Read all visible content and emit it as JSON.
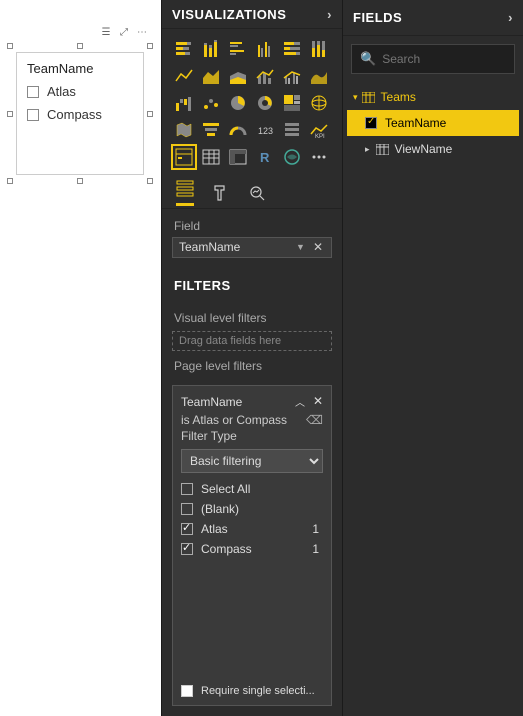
{
  "canvas": {
    "slicer": {
      "title": "TeamName",
      "items": [
        {
          "label": "Atlas",
          "checked": false
        },
        {
          "label": "Compass",
          "checked": false
        }
      ],
      "toolbar_icons": [
        "slicer-mode-icon",
        "focus-icon",
        "more-icon"
      ]
    }
  },
  "visualizations": {
    "header": "VISUALIZATIONS",
    "field_label": "Field",
    "field_value": "TeamName",
    "filters_header": "FILTERS",
    "visual_level_label": "Visual level filters",
    "visual_level_placeholder": "Drag data fields here",
    "page_level_label": "Page level filters",
    "filter_card": {
      "field": "TeamName",
      "restatement": "is Atlas or Compass",
      "type_label": "Filter Type",
      "type_value": "Basic filtering",
      "options": [
        {
          "label": "Select All",
          "checked": false,
          "count": ""
        },
        {
          "label": "(Blank)",
          "checked": false,
          "count": ""
        },
        {
          "label": "Atlas",
          "checked": true,
          "count": "1"
        },
        {
          "label": "Compass",
          "checked": true,
          "count": "1"
        }
      ],
      "require_single_label": "Require single selecti..."
    }
  },
  "fields": {
    "header": "FIELDS",
    "search_placeholder": "Search",
    "table": "Teams",
    "columns": [
      {
        "label": "TeamName",
        "checked": true,
        "selected": true
      },
      {
        "label": "ViewName",
        "checked": false,
        "selected": false
      }
    ]
  }
}
